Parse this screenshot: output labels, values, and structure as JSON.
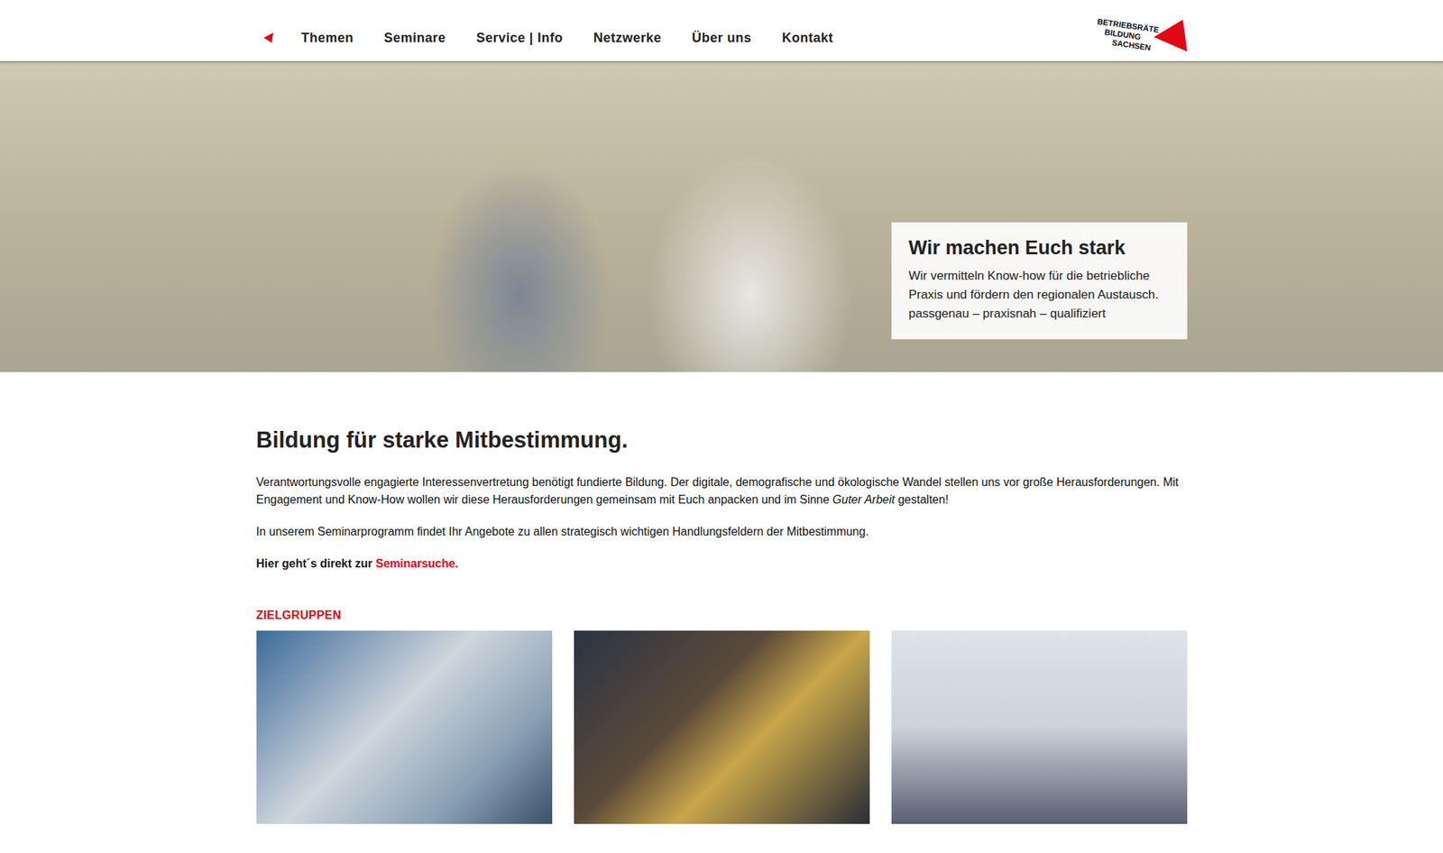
{
  "nav": {
    "items": [
      "Themen",
      "Seminare",
      "Service | Info",
      "Netzwerke",
      "Über uns",
      "Kontakt"
    ]
  },
  "logo": {
    "lines": [
      "BETRIEBSRÄTE",
      "BILDUNG",
      "SACHSEN"
    ]
  },
  "hero": {
    "title": "Wir machen Euch stark",
    "lines": [
      "Wir vermitteln Know-how für die betriebliche Praxis und fördern den regionalen Austausch.",
      "passgenau – praxisnah – qualifiziert"
    ]
  },
  "intro": {
    "heading": "Bildung für starke Mitbestimmung.",
    "paragraphs": [
      [
        {
          "text": "Verantwortungsvolle engagierte Interessenvertretung benötigt fundierte Bildung. Der digitale, demografische und ökologische Wandel stellen uns vor große Herausforderungen. Mit Engagement und Know-How wollen wir diese Herausforderungen gemeinsam mit Euch anpacken und im Sinne ",
          "italic": false
        },
        {
          "text": "Guter Arbeit",
          "italic": true
        },
        {
          "text": " gestalten!",
          "italic": false
        }
      ],
      [
        {
          "text": "In unserem Seminarprogramm findet Ihr Angebote zu allen strategisch wichtigen Handlungsfeldern der Mitbestimmung.",
          "italic": false
        }
      ]
    ],
    "cta": {
      "text": "Hier geht´s direkt zur ",
      "link": "Seminarsuche."
    }
  },
  "target_groups": {
    "label": "ZIELGRUPPEN",
    "cards": [
      {
        "kind": "photo"
      },
      {
        "kind": "photo"
      },
      {
        "kind": "photo"
      }
    ]
  }
}
